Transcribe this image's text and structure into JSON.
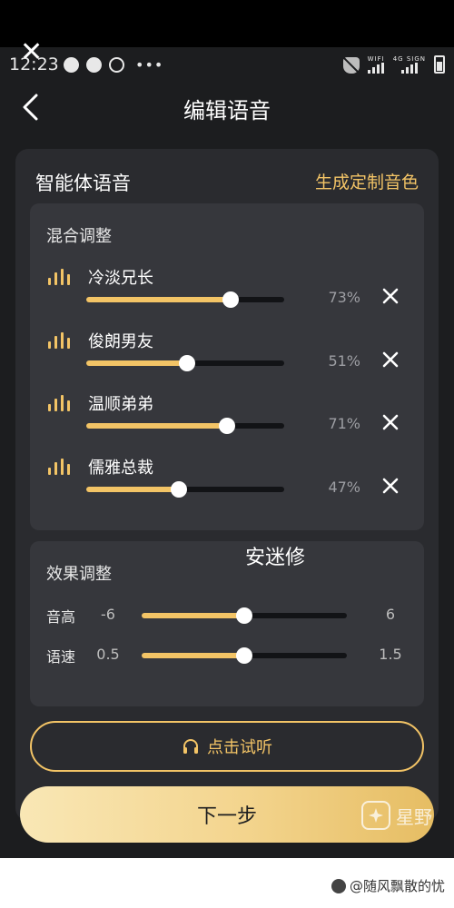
{
  "statusbar": {
    "time": "12:23",
    "wifi_label": "WIFI",
    "signal_label": "4G SIGN"
  },
  "nav": {
    "title": "编辑语音",
    "back_icon": "chevron-left-icon"
  },
  "card": {
    "title": "智能体语音",
    "custom_link": "生成定制音色"
  },
  "mix": {
    "title": "混合调整",
    "voices": [
      {
        "name": "冷淡兄长",
        "percent_label": "73%",
        "value": 0.73
      },
      {
        "name": "俊朗男友",
        "percent_label": "51%",
        "value": 0.51
      },
      {
        "name": "温顺弟弟",
        "percent_label": "71%",
        "value": 0.71
      },
      {
        "name": "儒雅总裁",
        "percent_label": "47%",
        "value": 0.47
      }
    ]
  },
  "watermark_name": "安迷修",
  "effects": {
    "title": "效果调整",
    "pitch": {
      "label": "音高",
      "min": "-6",
      "max": "6",
      "value": 0
    },
    "speed": {
      "label": "语速",
      "min": "0.5",
      "max": "1.5",
      "value": 1.0
    }
  },
  "listen_button": {
    "label": "点击试听",
    "icon": "headphones-icon"
  },
  "next_button": {
    "label": "下一步"
  },
  "brand_watermark": "星野",
  "credit": "@随风飘散的忧",
  "colors": {
    "accent": "#f3c466",
    "background": "#1c1d1f",
    "card": "#2a2b2f",
    "panel": "#36373c"
  }
}
